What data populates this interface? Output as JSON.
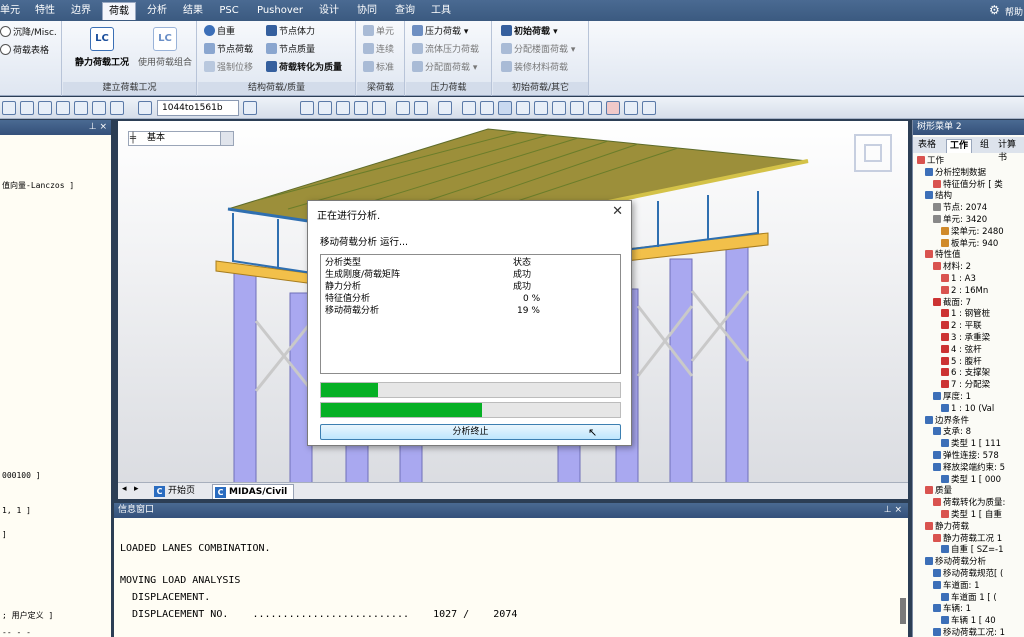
{
  "menu": {
    "tabs": [
      "单元",
      "特性",
      "边界",
      "荷载",
      "分析",
      "结果",
      "PSC",
      "Pushover",
      "设计",
      "协同",
      "查询",
      "工具"
    ],
    "active_tab": "荷载",
    "help_label": "帮助"
  },
  "ribbon": {
    "partial_group": {
      "items": [
        "沉降/Misc.",
        "荷载表格"
      ]
    },
    "group_create": {
      "label": "建立荷载工况",
      "buttons": [
        {
          "label": "静力荷载工况",
          "icon_text": "LC"
        },
        {
          "label": "使用荷载组合",
          "icon_text": "LC"
        }
      ]
    },
    "group_structure": {
      "label": "结构荷载/质量",
      "items": [
        "自重",
        "节点体力",
        "节点荷载",
        "节点质量",
        "强制位移",
        "荷载转化为质量"
      ]
    },
    "group_beam": {
      "label": "梁荷载",
      "items": [
        "单元",
        "连续",
        "标准"
      ]
    },
    "group_pressure": {
      "label": "压力荷载",
      "items": [
        "压力荷载",
        "流体压力荷载",
        "分配面荷载"
      ]
    },
    "group_initial": {
      "label": "初始荷载/其它",
      "items": [
        "初始荷载",
        "分配楼面荷载",
        "装修材料荷载"
      ]
    }
  },
  "toolbar": {
    "combo_value": "1044to1561b"
  },
  "left_panel": {
    "lines": [
      "值向量-Lanczos ]",
      "000100 ]",
      "1, 1 ]",
      "]",
      "; 用户定义 ]",
      "-- - -"
    ]
  },
  "viewport": {
    "combo_value": "基本",
    "tabs": [
      "开始页",
      "MIDAS/Civil"
    ],
    "active_tab": "MIDAS/Civil"
  },
  "dialog": {
    "title": "正在进行分析.",
    "status": "移动荷载分析 运行...",
    "columns": [
      "分析类型",
      "状态"
    ],
    "rows": [
      {
        "type": "生成刚度/荷载矩阵",
        "status": "成功"
      },
      {
        "type": "静力分析",
        "status": "成功"
      },
      {
        "type": "特征值分析",
        "status": "0 %"
      },
      {
        "type": "移动荷载分析",
        "status": "19 %"
      }
    ],
    "progress_1": 0.19,
    "progress_2": 0.54,
    "stop_button": "分析终止"
  },
  "info_window": {
    "title": "信息窗口",
    "lines": [
      "LOADED LANES COMBINATION.",
      "",
      "MOVING LOAD ANALYSIS",
      "  DISPLACEMENT.",
      "  DISPLACEMENT NO.    ..........................    1027 /    2074"
    ]
  },
  "tree_panel": {
    "title": "树形菜单 2",
    "tabs": [
      "表格",
      "工作",
      "组",
      "计算书"
    ],
    "active_tab": "工作",
    "nodes": [
      "工作",
      "分析控制数据",
      "特征值分析 [ 类",
      "结构",
      "节点: 2074",
      "单元: 3420",
      "梁单元: 2480",
      "板单元: 940",
      "特性值",
      "材料: 2",
      "1 : A3",
      "2 : 16Mn",
      "截面: 7",
      "1 : 钢管桩",
      "2 : 平联",
      "3 : 承重梁",
      "4 : 弦杆",
      "5 : 腹杆",
      "6 : 支撑架",
      "7 : 分配梁",
      "厚度: 1",
      "1 : 10 (Val",
      "边界条件",
      "支承: 8",
      "类型 1 [ 111",
      "弹性连接: 578",
      "释放梁端约束: 5",
      "类型 1 [ 000",
      "质量",
      "荷载转化为质量:",
      "类型 1 [ 自重",
      "静力荷载",
      "静力荷载工况 1",
      "自重 [ SZ=-1",
      "移动荷载分析",
      "移动荷载规范[ (",
      "车道面: 1",
      "车道面 1 [ (",
      "车辆: 1",
      "车辆 1 [ 40",
      "移动荷载工况: 1"
    ]
  }
}
